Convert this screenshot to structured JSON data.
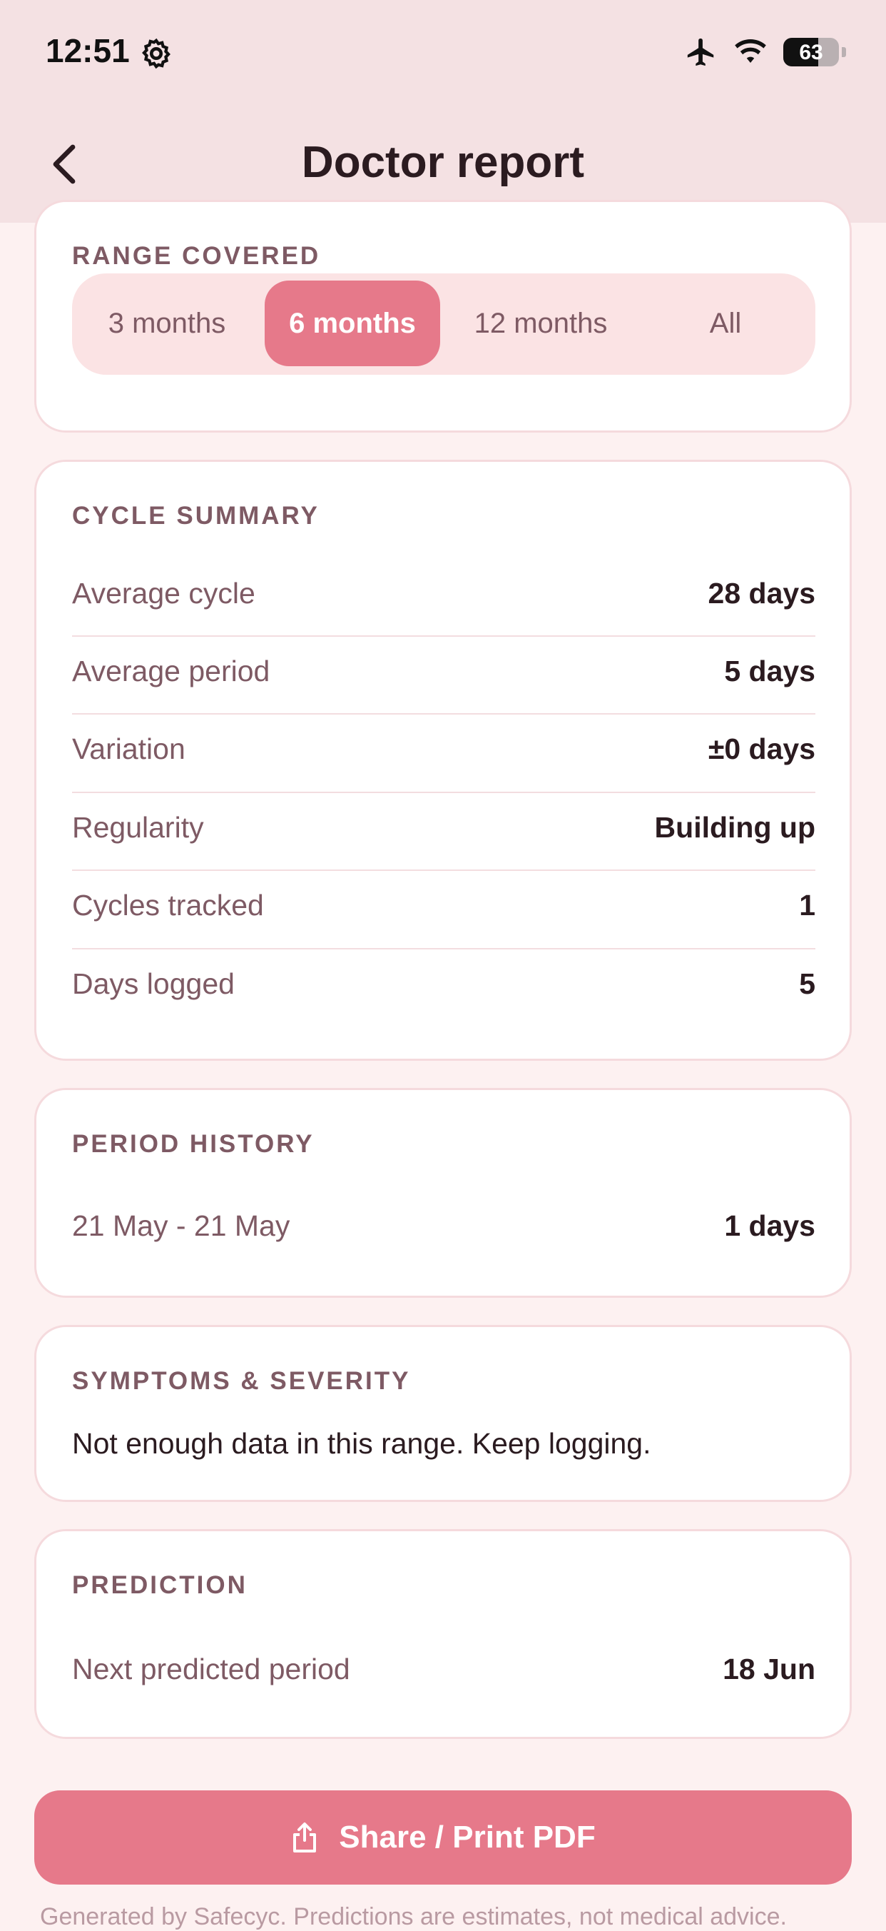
{
  "status": {
    "time": "12:51",
    "battery": "63",
    "battery_level": 0.63
  },
  "nav": {
    "title": "Doctor report"
  },
  "range": {
    "title": "RANGE COVERED",
    "options": [
      "3 months",
      "6 months",
      "12 months",
      "All"
    ],
    "selected": "6 months"
  },
  "cycle_summary": {
    "title": "CYCLE SUMMARY",
    "rows": [
      {
        "label": "Average cycle",
        "value": "28 days"
      },
      {
        "label": "Average period",
        "value": "5 days"
      },
      {
        "label": "Variation",
        "value": "±0 days"
      },
      {
        "label": "Regularity",
        "value": "Building up"
      },
      {
        "label": "Cycles tracked",
        "value": "1"
      },
      {
        "label": "Days logged",
        "value": "5"
      }
    ]
  },
  "period_history": {
    "title": "PERIOD HISTORY",
    "rows": [
      {
        "label": "21 May - 21 May",
        "value": "1 days"
      }
    ]
  },
  "symptoms": {
    "title": "SYMPTOMS & SEVERITY",
    "message": "Not enough data in this range. Keep logging."
  },
  "prediction": {
    "title": "PREDICTION",
    "rows": [
      {
        "label": "Next predicted period",
        "value": "18 Jun"
      }
    ]
  },
  "share": {
    "label": "Share / Print PDF"
  },
  "footer": {
    "note": "Generated by Safecyc. Predictions are estimates, not medical advice."
  },
  "colors": {
    "accent": "#e6798a",
    "header_bg": "#f4e1e3",
    "card_border": "#f5dadd"
  }
}
